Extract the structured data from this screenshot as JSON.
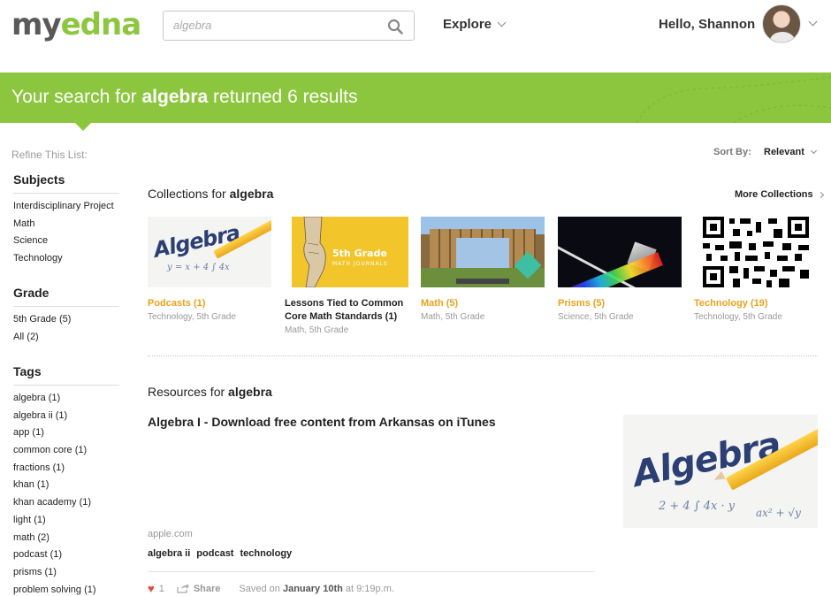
{
  "header": {
    "logo_my": "my",
    "logo_edna": "edna",
    "search_value": "algebra",
    "search_placeholder": "algebra",
    "explore_label": "Explore",
    "greeting": "Hello, Shannon"
  },
  "banner": {
    "prefix": "Your search for ",
    "query": "algebra",
    "suffix": " returned 6 results"
  },
  "sidebar": {
    "refine_label": "Refine This List:",
    "subjects_heading": "Subjects",
    "subjects": [
      "Interdisciplinary Project",
      "Math",
      "Science",
      "Technology"
    ],
    "grade_heading": "Grade",
    "grades": [
      "5th Grade (5)",
      "All (2)"
    ],
    "tags_heading": "Tags",
    "tags": [
      "algebra (1)",
      "algebra ii (1)",
      "app (1)",
      "common core (1)",
      "fractions (1)",
      "khan (1)",
      "khan academy (1)",
      "light (1)",
      "math (2)",
      "podcast (1)",
      "prisms (1)",
      "problem solving (1)"
    ]
  },
  "sort": {
    "label": "Sort By:",
    "value": "Relevant"
  },
  "collections": {
    "title_prefix": "Collections for ",
    "title_query": "algebra",
    "more_label": "More Collections",
    "items": [
      {
        "title": "Podcasts (1)",
        "subtitle": "Technology, 5th Grade"
      },
      {
        "title": "Lessons Tied to Common Core Math Standards (1)",
        "subtitle": "Math, 5th Grade"
      },
      {
        "title": "Math (5)",
        "subtitle": "Math, 5th Grade"
      },
      {
        "title": "Prisms (5)",
        "subtitle": "Science, 5th Grade"
      },
      {
        "title": "Technology (19)",
        "subtitle": "Technology, 5th Grade"
      }
    ],
    "journal_line1": "5th Grade",
    "journal_line2": "MATH JOURNALS"
  },
  "resources": {
    "title_prefix": "Resources for ",
    "title_query": "algebra",
    "item": {
      "title": "Algebra I - Download free content from Arkansas on iTunes",
      "source": "apple.com",
      "tags": [
        "algebra ii",
        "podcast",
        "technology"
      ],
      "likes": "1",
      "share_label": "Share",
      "saved_prefix": "Saved on ",
      "saved_date": "January 10th",
      "saved_suffix": " at 9:19p.m."
    },
    "image_word": "Algebra"
  },
  "colors": {
    "brand_green": "#8cc63e",
    "accent_orange": "#e8a21c",
    "heart_red": "#e24b3a"
  }
}
